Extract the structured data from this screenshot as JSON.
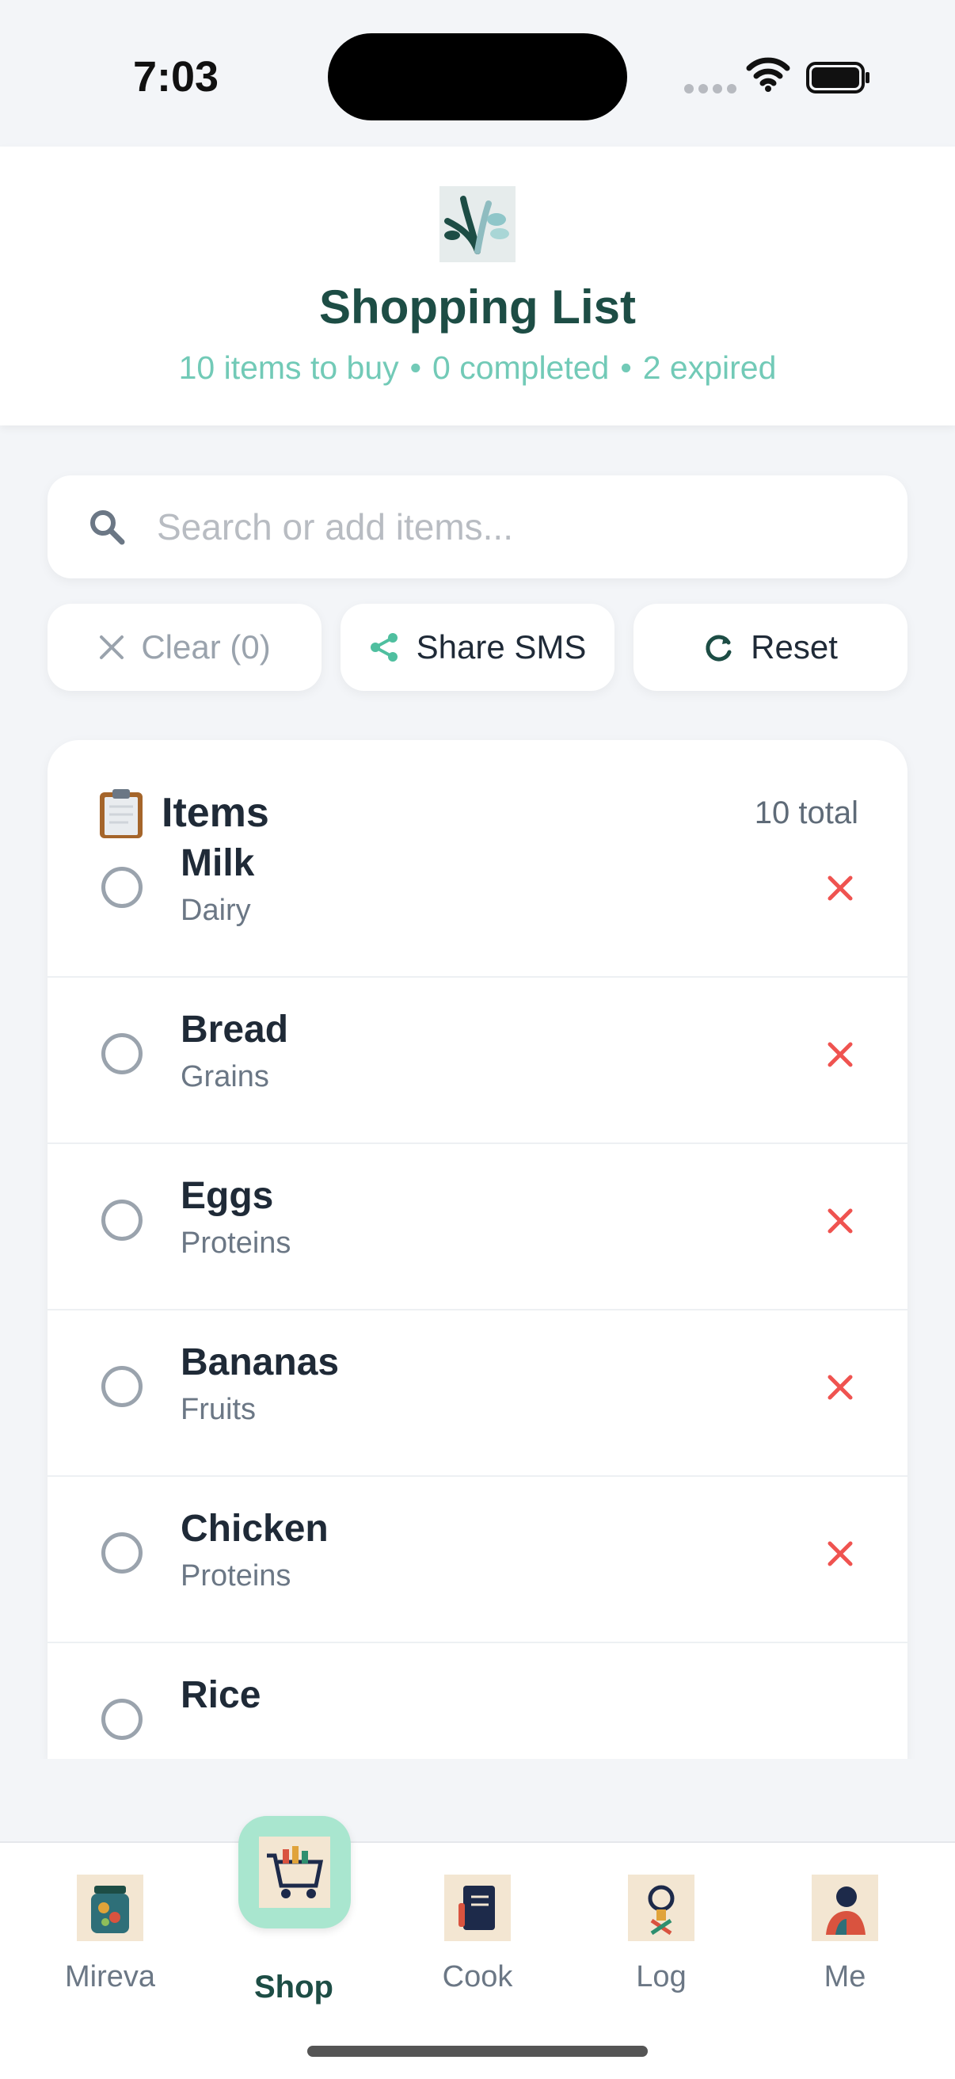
{
  "status": {
    "time": "7:03"
  },
  "header": {
    "title": "Shopping List",
    "stats": {
      "to_buy": "10 items to buy",
      "completed": "0 completed",
      "expired": "2 expired",
      "separator": "•"
    }
  },
  "search": {
    "placeholder": "Search or add items...",
    "value": ""
  },
  "actions": {
    "clear": "Clear (0)",
    "share": "Share SMS",
    "reset": "Reset"
  },
  "list": {
    "title": "Items",
    "count": "10 total",
    "items": [
      {
        "name": "Milk",
        "category": "Dairy"
      },
      {
        "name": "Bread",
        "category": "Grains"
      },
      {
        "name": "Eggs",
        "category": "Proteins"
      },
      {
        "name": "Bananas",
        "category": "Fruits"
      },
      {
        "name": "Chicken",
        "category": "Proteins"
      },
      {
        "name": "Rice",
        "category": ""
      }
    ]
  },
  "nav": {
    "tabs": [
      {
        "label": "Mireva"
      },
      {
        "label": "Shop",
        "active": true
      },
      {
        "label": "Cook"
      },
      {
        "label": "Log"
      },
      {
        "label": "Me"
      }
    ]
  },
  "colors": {
    "accent": "#1d4d45",
    "subtitle": "#72cab7",
    "delete": "#ef5350",
    "active_tab": "#a9e6cf"
  },
  "icons": [
    "search-icon",
    "close-icon",
    "share-icon",
    "refresh-icon",
    "clipboard-icon",
    "wifi-icon",
    "battery-icon"
  ]
}
